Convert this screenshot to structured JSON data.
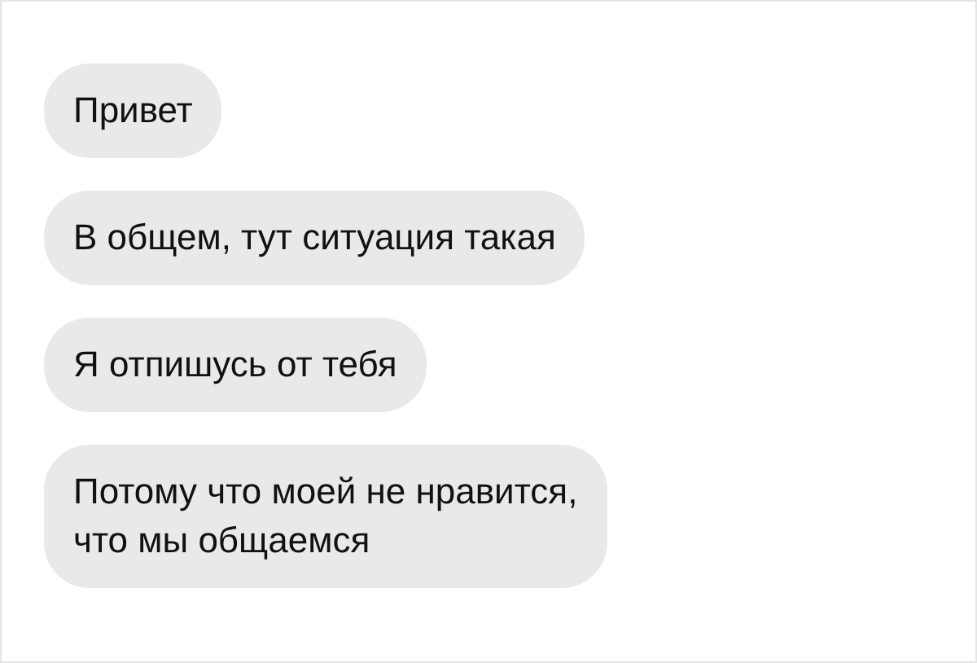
{
  "messages": [
    {
      "text": "Привет"
    },
    {
      "text": "В общем, тут ситуация такая"
    },
    {
      "text": "Я отпишусь от тебя"
    },
    {
      "text": "Потому что моей не нравится,\nчто мы общаемся"
    }
  ]
}
